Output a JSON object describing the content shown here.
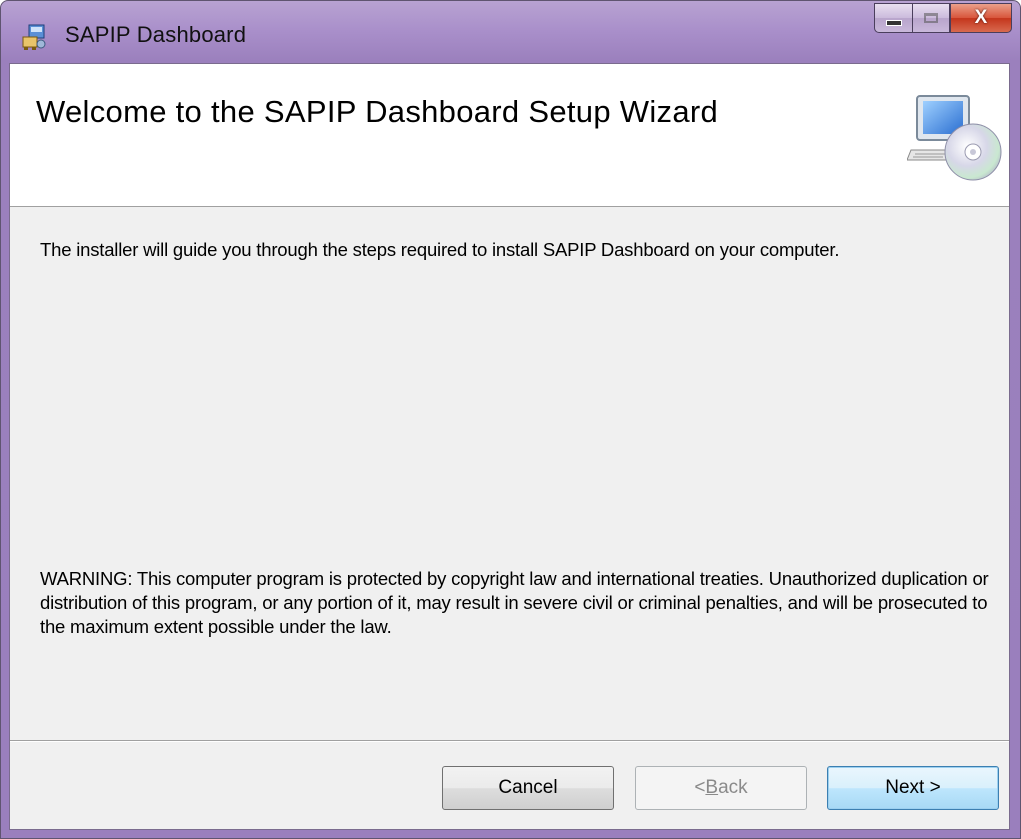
{
  "window": {
    "title": "SAPIP Dashboard",
    "close_glyph": "X",
    "icons": [
      "installer-app-icon",
      "minimize-icon",
      "maximize-icon",
      "close-icon",
      "computer-cd-icon"
    ]
  },
  "banner": {
    "title": "Welcome to the SAPIP Dashboard Setup Wizard"
  },
  "body": {
    "intro": "The installer will guide you through the steps required to install SAPIP Dashboard on your computer.",
    "warning": "WARNING: This computer program is protected by copyright law and international treaties. Unauthorized duplication or distribution of this program, or any portion of it, may result in severe civil or criminal penalties, and will be prosecuted to the maximum extent possible under the law."
  },
  "buttons": {
    "cancel": "Cancel",
    "back_prefix": "< ",
    "back_accel": "B",
    "back_rest": "ack",
    "next": "Next >"
  },
  "colors": {
    "titlebar": "#a98fca",
    "client_bg": "#f0f0f0",
    "banner_bg": "#ffffff",
    "close_button": "#c4351c",
    "default_button_border": "#3c7fb1"
  }
}
